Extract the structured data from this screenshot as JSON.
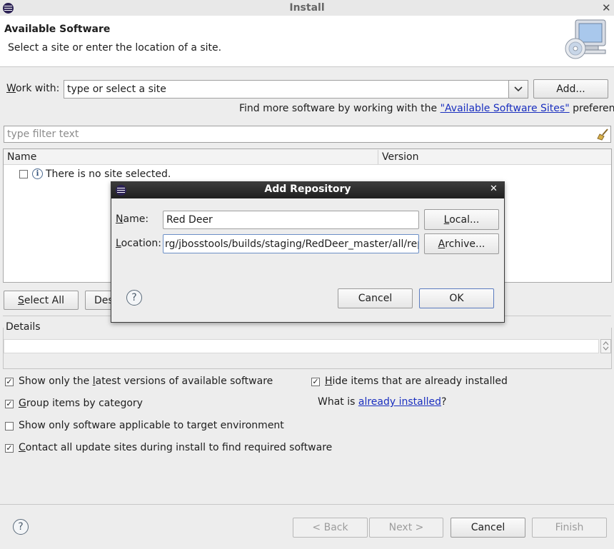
{
  "window": {
    "title": "Install"
  },
  "banner": {
    "title": "Available Software",
    "subtitle": "Select a site or enter the location of a site."
  },
  "work_with": {
    "label_pre": "W",
    "label_post": "ork with:",
    "value": "type or select a site",
    "add_button": "Add..."
  },
  "find_more": {
    "prefix": "Find more software by working with the ",
    "link": "\"Available Software Sites\"",
    "suffix": " preferences."
  },
  "filter": {
    "placeholder": "type filter text"
  },
  "table": {
    "columns": [
      "Name",
      "Version"
    ],
    "rows": [
      {
        "name": "There is no site selected.",
        "version": ""
      }
    ]
  },
  "buttons": {
    "select_all_pre": "",
    "select_all_u": "S",
    "select_all_post": "elect All",
    "deselect_all_visible": "Des"
  },
  "details": {
    "label": "Details"
  },
  "options": {
    "show_latest": {
      "pre": "Show only the ",
      "u": "l",
      "post": "atest versions of available software",
      "checked": true
    },
    "group_category": {
      "pre": "",
      "u": "G",
      "post": "roup items by category",
      "checked": true
    },
    "applicable_target": {
      "pre": "Show only software applicable to target environment",
      "u": "",
      "post": "",
      "checked": false
    },
    "contact_sites": {
      "pre": "",
      "u": "C",
      "post": "ontact all update sites during install to find required software",
      "checked": true
    },
    "hide_installed": {
      "pre": "",
      "u": "H",
      "post": "ide items that are already installed",
      "checked": true
    }
  },
  "what_is": {
    "prefix": "What is ",
    "link": "already installed",
    "suffix": "?"
  },
  "footer": {
    "back": "< Back",
    "back_u": "B",
    "next": "Next >",
    "next_u": "N",
    "cancel": "Cancel",
    "finish": "Finish",
    "finish_u": "F"
  },
  "dialog": {
    "title": "Add Repository",
    "name_label_u": "N",
    "name_label_post": "ame:",
    "name_value": "Red Deer",
    "location_label_u": "L",
    "location_label_post": "ocation:",
    "location_value": "rg/jbosstools/builds/staging/RedDeer_master/all/repo/",
    "local_button_u": "L",
    "local_button_post": "ocal...",
    "archive_button_u": "A",
    "archive_button_post": "rchive...",
    "cancel": "Cancel",
    "ok": "OK"
  },
  "icons": [
    "eclipse-logo-icon",
    "close-icon",
    "install-cd-computer-icon",
    "dropdown-arrow-icon",
    "clear-filter-broom-icon",
    "info-icon",
    "help-icon",
    "scroll-up-icon",
    "scroll-down-icon",
    "checkmark-icon"
  ]
}
